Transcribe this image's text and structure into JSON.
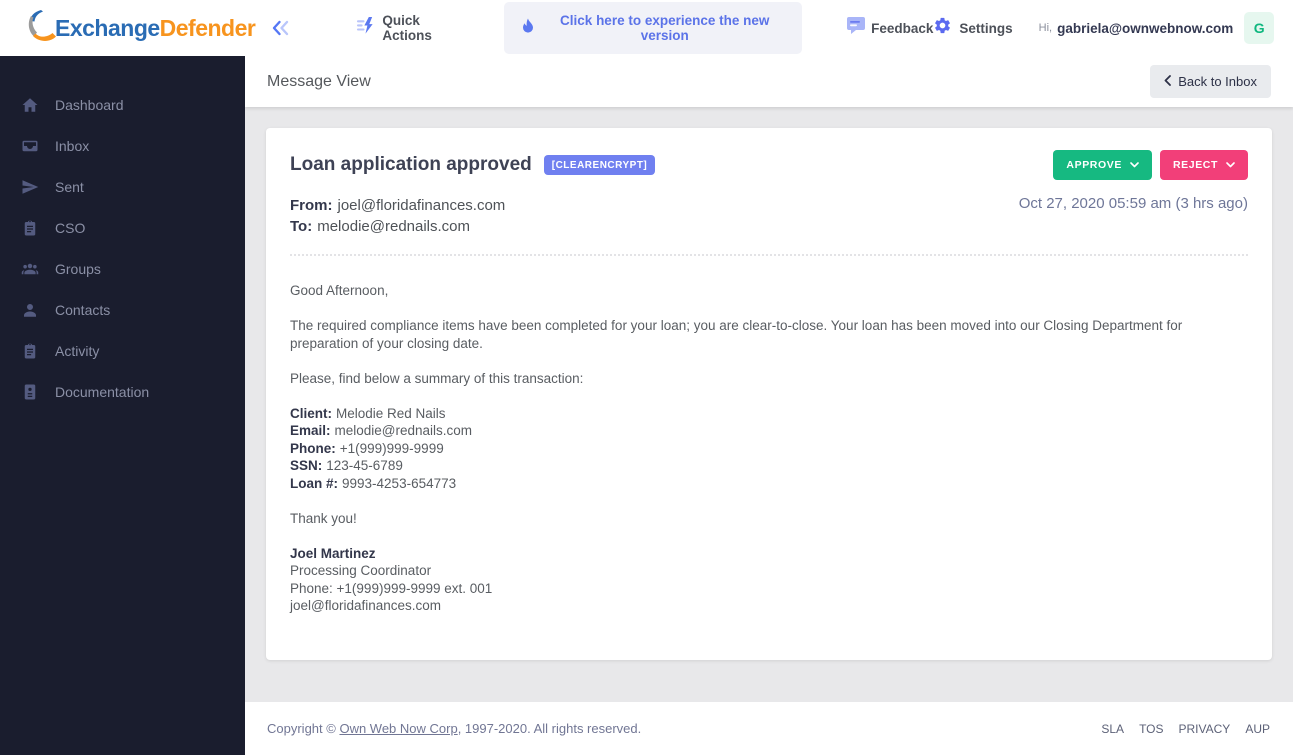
{
  "header": {
    "logo_part1": "Exchange",
    "logo_part2": "Defender",
    "quick_actions_label": "Quick Actions",
    "new_version_label": "Click here to experience the new version",
    "feedback_label": "Feedback",
    "settings_label": "Settings",
    "greeting": "Hi,",
    "user_email": "gabriela@ownwebnow.com",
    "avatar_initial": "G"
  },
  "sidebar": {
    "items": [
      {
        "label": "Dashboard",
        "icon": "home-icon"
      },
      {
        "label": "Inbox",
        "icon": "inbox-icon"
      },
      {
        "label": "Sent",
        "icon": "send-icon"
      },
      {
        "label": "CSO",
        "icon": "clipboard-icon"
      },
      {
        "label": "Groups",
        "icon": "users-icon"
      },
      {
        "label": "Contacts",
        "icon": "person-icon"
      },
      {
        "label": "Activity",
        "icon": "clipboard-icon"
      },
      {
        "label": "Documentation",
        "icon": "id-badge-icon"
      }
    ]
  },
  "page": {
    "title": "Message View",
    "back_button_label": "Back to Inbox"
  },
  "message": {
    "subject": "Loan application approved",
    "badge": "[CLEARENCRYPT]",
    "approve_label": "APPROVE",
    "reject_label": "REJECT",
    "from_label": "From:",
    "from_value": "joel@floridafinances.com",
    "to_label": "To:",
    "to_value": "melodie@rednails.com",
    "date": "Oct 27, 2020 05:59 am (3 hrs ago)",
    "body": {
      "greeting": "Good Afternoon,",
      "paragraph1": "The required compliance items have been completed for your loan; you are clear-to-close. Your loan has been moved into our Closing Department for preparation of your closing date.",
      "paragraph2": "Please, find below a summary of this transaction:",
      "details": [
        {
          "label": "Client:",
          "value": "Melodie Red Nails"
        },
        {
          "label": "Email:",
          "value": "melodie@rednails.com"
        },
        {
          "label": "Phone:",
          "value": "+1(999)999-9999"
        },
        {
          "label": "SSN:",
          "value": "123-45-6789"
        },
        {
          "label": "Loan #:",
          "value": "9993-4253-654773"
        }
      ],
      "closing": "Thank you!",
      "signature_name": "Joel Martinez",
      "signature_lines": [
        "Processing Coordinator",
        "Phone: +1(999)999-9999 ext. 001",
        "joel@floridafinances.com"
      ]
    }
  },
  "footer": {
    "copyright_prefix": "Copyright ©",
    "company_link": "Own Web Now Corp",
    "copyright_suffix": ", 1997-2020. All rights reserved.",
    "links": [
      "SLA",
      "TOS",
      "PRIVACY",
      "AUP"
    ]
  },
  "colors": {
    "accent_blue": "#5b73e8",
    "badge_blue": "#7080f0",
    "approve_green": "#16b981",
    "reject_pink": "#f23f79",
    "sidebar_bg": "#1a1d2e",
    "avatar_green": "#0fb77f",
    "logo_blue": "#2a6cb4",
    "logo_orange": "#f7941e"
  }
}
